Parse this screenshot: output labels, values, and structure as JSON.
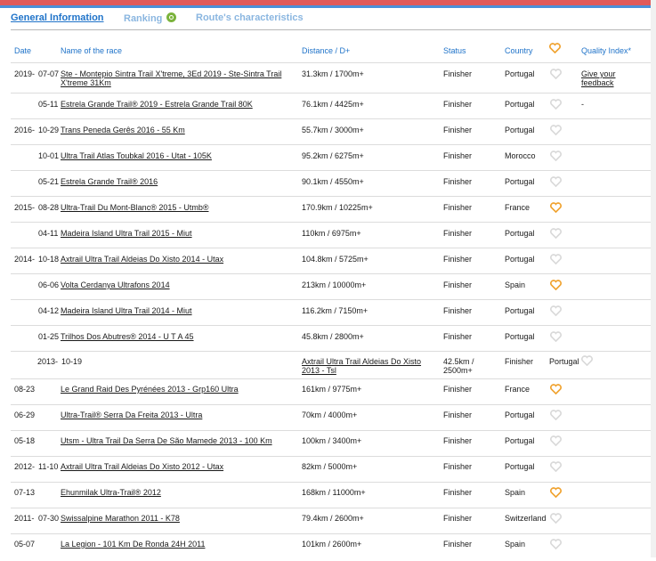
{
  "tabs": [
    {
      "label": "General Information",
      "active": true
    },
    {
      "label": "Ranking",
      "active": false
    },
    {
      "label": "Route's characteristics",
      "active": false
    }
  ],
  "table": {
    "headers": {
      "date": "Date",
      "name": "Name of the race",
      "distance": "Distance / D+",
      "status": "Status",
      "country": "Country",
      "quality": "Quality Index*"
    },
    "rows": [
      {
        "year": "2019-",
        "date": "07-07",
        "name_line1": "Ste - Montepio Sintra Trail X'treme, 3Ed 2019 - Ste-Sintra Trail",
        "name_line2": "X'treme 31Km",
        "distance": "31.3km / 1700m+",
        "status": "Finisher",
        "country": "Portugal",
        "fav": false,
        "quality_line1": "Give your",
        "quality_line2": "feedback"
      },
      {
        "year": "",
        "date": "05-11",
        "name_line1": "Estrela Grande Trail® 2019 - Estrela Grande Trail 80K",
        "name_line2": "",
        "distance": "76.1km / 4425m+",
        "status": "Finisher",
        "country": "Portugal",
        "fav": false,
        "quality_line1": "-",
        "quality_line2": ""
      },
      {
        "year": "2016-",
        "date": "10-29",
        "name_line1": "Trans Peneda Gerês 2016 - 55 Km",
        "name_line2": "",
        "distance": "55.7km / 3000m+",
        "status": "Finisher",
        "country": "Portugal",
        "fav": false,
        "quality_line1": "",
        "quality_line2": ""
      },
      {
        "year": "",
        "date": "10-01",
        "name_line1": "Ultra Trail Atlas Toubkal 2016 - Utat - 105K",
        "name_line2": "",
        "distance": "95.2km / 6275m+",
        "status": "Finisher",
        "country": "Morocco",
        "fav": false,
        "quality_line1": "",
        "quality_line2": ""
      },
      {
        "year": "",
        "date": "05-21",
        "name_line1": "Estrela Grande Trail® 2016",
        "name_line2": "",
        "distance": "90.1km / 4550m+",
        "status": "Finisher",
        "country": "Portugal",
        "fav": false,
        "quality_line1": "",
        "quality_line2": ""
      },
      {
        "year": "2015-",
        "date": "08-28",
        "name_line1": "Ultra-Trail Du Mont-Blanc® 2015 - Utmb®",
        "name_line2": "",
        "distance": "170.9km / 10225m+",
        "status": "Finisher",
        "country": "France",
        "fav": true,
        "quality_line1": "",
        "quality_line2": ""
      },
      {
        "year": "",
        "date": "04-11",
        "name_line1": "Madeira Island Ultra Trail 2015 - Miut",
        "name_line2": "",
        "distance": "110km / 6975m+",
        "status": "Finisher",
        "country": "Portugal",
        "fav": false,
        "quality_line1": "",
        "quality_line2": ""
      },
      {
        "year": "2014-",
        "date": "10-18",
        "name_line1": "Axtrail Ultra Trail Aldeias Do Xisto 2014 - Utax",
        "name_line2": "",
        "distance": "104.8km / 5725m+",
        "status": "Finisher",
        "country": "Portugal",
        "fav": false,
        "quality_line1": "",
        "quality_line2": ""
      },
      {
        "year": "",
        "date": "06-06",
        "name_line1": "Volta Cerdanya Ultrafons 2014",
        "name_line2": "",
        "distance": "213km / 10000m+",
        "status": "Finisher",
        "country": "Spain",
        "fav": true,
        "quality_line1": "",
        "quality_line2": ""
      },
      {
        "year": "",
        "date": "04-12",
        "name_line1": "Madeira Island Ultra Trail 2014 - Miut",
        "name_line2": "",
        "distance": "116.2km / 7150m+",
        "status": "Finisher",
        "country": "Portugal",
        "fav": false,
        "quality_line1": "",
        "quality_line2": ""
      },
      {
        "year": "",
        "date": "01-25",
        "name_line1": "Trilhos Dos Abutres® 2014 - U T A 45",
        "name_line2": "",
        "distance": "45.8km / 2800m+",
        "status": "Finisher",
        "country": "Portugal",
        "fav": false,
        "quality_line1": "",
        "quality_line2": ""
      }
    ],
    "shifted_row": {
      "year": "2013-",
      "date": "10-19",
      "name_line1": "Axtrail Ultra Trail Aldeias Do Xisto",
      "name_line2": "2013 - Tsl",
      "distance_line1": "42.5km /",
      "distance_line2": "2500m+",
      "status": "Finisher",
      "country": "Portugal",
      "fav": false
    },
    "late_rows": [
      {
        "year": "",
        "date": "08-23",
        "name_line1": "Le Grand Raid Des Pyrénées 2013 - Grp160 Ultra",
        "distance": "161km / 9775m+",
        "status": "Finisher",
        "country": "France",
        "fav": true
      },
      {
        "year": "",
        "date": "06-29",
        "name_line1": "Ultra-Trail® Serra Da Freita 2013 - Ultra",
        "distance": "70km / 4000m+",
        "status": "Finisher",
        "country": "Portugal",
        "fav": false
      },
      {
        "year": "",
        "date": "05-18",
        "name_line1": "Utsm - Ultra Trail Da Serra De São Mamede 2013 - 100 Km",
        "distance": "100km / 3400m+",
        "status": "Finisher",
        "country": "Portugal",
        "fav": false
      },
      {
        "year": "2012-",
        "date": "11-10",
        "name_line1": "Axtrail Ultra Trail Aldeias Do Xisto 2012 - Utax",
        "distance": "82km / 5000m+",
        "status": "Finisher",
        "country": "Portugal",
        "fav": false
      },
      {
        "year": "",
        "date": "07-13",
        "name_line1": "Ehunmilak Ultra-Trail® 2012",
        "distance": "168km / 11000m+",
        "status": "Finisher",
        "country": "Spain",
        "fav": true
      },
      {
        "year": "2011-",
        "date": "07-30",
        "name_line1": "Swissalpine Marathon 2011 - K78",
        "distance": "79.4km / 2600m+",
        "status": "Finisher",
        "country": "Switzerland",
        "fav": false
      },
      {
        "year": "",
        "date": "05-07",
        "name_line1": "La Legion - 101 Km De Ronda 24H 2011",
        "distance": "101km / 2600m+",
        "status": "Finisher",
        "country": "Spain",
        "fav": false
      }
    ]
  },
  "colors": {
    "accent": "#1f73c9",
    "heart_active": "#f0a22e",
    "heart_inactive": "#d9d9d9"
  }
}
